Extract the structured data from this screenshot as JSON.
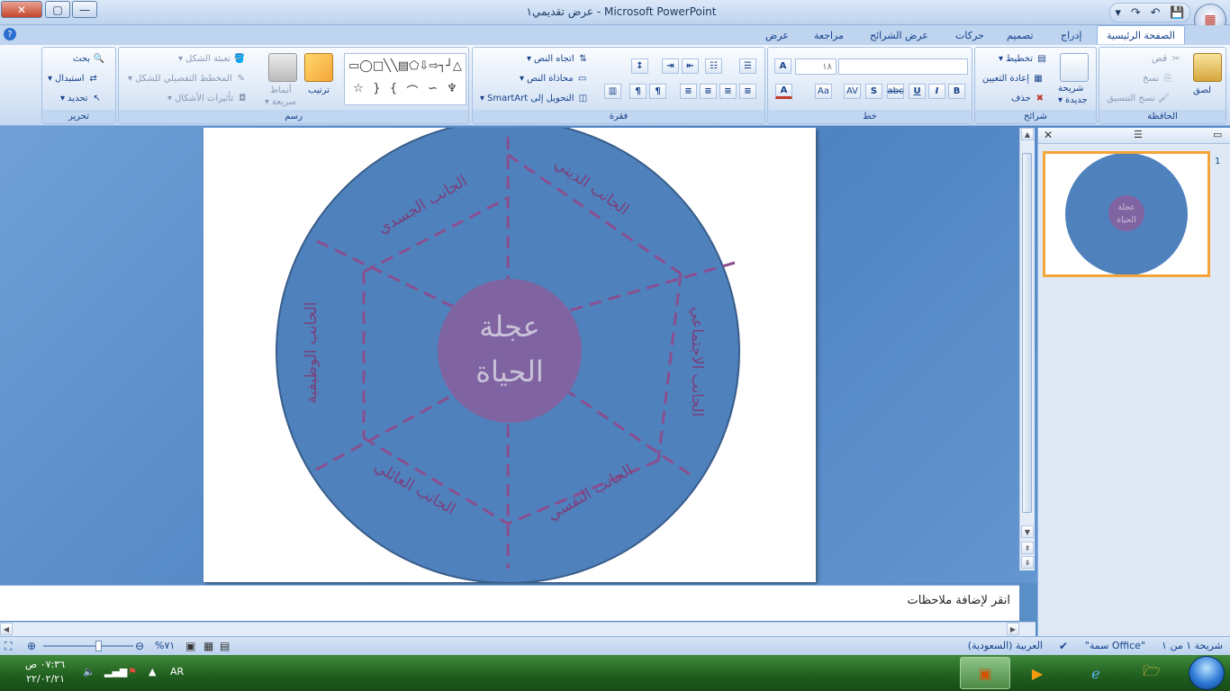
{
  "window": {
    "title": "عرض تقديمي١ - Microsoft PowerPoint",
    "close": "✕",
    "maximize": "▢",
    "minimize": "—"
  },
  "quick_access": {
    "save": "💾",
    "undo": "↶",
    "redo": "↷",
    "more": "▾"
  },
  "tabs": [
    {
      "id": "home",
      "label": "الصفحة الرئيسية",
      "active": true
    },
    {
      "id": "insert",
      "label": "إدراج"
    },
    {
      "id": "design",
      "label": "تصميم"
    },
    {
      "id": "animations",
      "label": "حركات"
    },
    {
      "id": "slideshow",
      "label": "عرض الشرائح"
    },
    {
      "id": "review",
      "label": "مراجعة"
    },
    {
      "id": "view",
      "label": "عرض"
    }
  ],
  "ribbon": {
    "clipboard": {
      "label": "الحافظة",
      "paste": "لصق",
      "cut": "قص",
      "copy": "نسخ",
      "format_painter": "نسخ التنسيق"
    },
    "slides": {
      "label": "شرائح",
      "new_slide_1": "شريحة",
      "new_slide_2": "جديدة",
      "layout": "تخطيط",
      "reset": "إعادة التعيين",
      "delete": "حذف"
    },
    "font": {
      "label": "خط",
      "size": "١٨"
    },
    "paragraph": {
      "label": "فقرة",
      "text_direction": "اتجاه النص",
      "align_text": "محاذاة النص",
      "smartart": "التحويل إلى SmartArt"
    },
    "drawing": {
      "label": "رسم",
      "arrange": "ترتيب",
      "quick_styles_1": "أنماط",
      "quick_styles_2": "سريعة",
      "shape_fill": "تعبئة الشكل",
      "shape_outline": "المخطط التفصيلي للشكل",
      "shape_effects": "تأثيرات الأشكال"
    },
    "editing": {
      "label": "تحرير",
      "find": "بحث",
      "replace": "استبدال",
      "select": "تحديد"
    }
  },
  "slide": {
    "center_line1": "عجلة",
    "center_line2": "الحياة",
    "segments": [
      "الجانب الديني",
      "الجانب الجسدي",
      "الجانب الوظيفية",
      "الجانب الاجتماعي",
      "الجانب العائلي",
      "الجانب النفسي"
    ],
    "colors": {
      "outer": "#4f81bd",
      "outer_stroke": "#385d8a",
      "center": "#8064a2",
      "dash": "#8a4f8f",
      "label": "#7b3f7b",
      "center_text": "#c9c2d9"
    }
  },
  "thumbnail": {
    "number": "1",
    "center_line1": "عجلة",
    "center_line2": "الحياة"
  },
  "notes": {
    "placeholder": "انقر لإضافة ملاحظات"
  },
  "status": {
    "slide_count": "شريحة ١ من ١",
    "theme": "\"سمة Office\"",
    "language": "العربية (السعودية)",
    "zoom": "%٧١"
  },
  "taskbar": {
    "time": "٠٧:٣٦ ص",
    "date": "٢٢/٠٢/٢١",
    "lang": "AR"
  }
}
